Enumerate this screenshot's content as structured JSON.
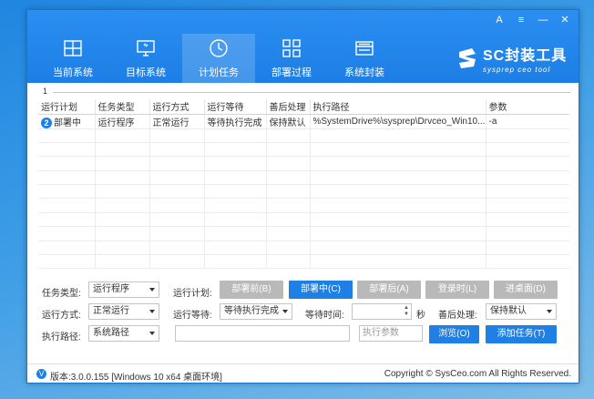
{
  "window_controls": [
    "A",
    "≡",
    "—",
    "✕"
  ],
  "nav": [
    {
      "label": "当前系统",
      "icon": "windows-icon"
    },
    {
      "label": "目标系统",
      "icon": "monitor-icon"
    },
    {
      "label": "计划任务",
      "icon": "clock-icon",
      "active": true
    },
    {
      "label": "部署过程",
      "icon": "grid-icon"
    },
    {
      "label": "系统封装",
      "icon": "drive-icon"
    }
  ],
  "logo": {
    "title": "SC封装工具",
    "subtitle": "sysprep ceo tool"
  },
  "tab_number": "1",
  "table": {
    "headers": [
      "运行计划",
      "任务类型",
      "运行方式",
      "运行等待",
      "善后处理",
      "执行路径",
      "参数"
    ],
    "rows": [
      {
        "badge": "2",
        "cells": [
          "部署中",
          "运行程序",
          "正常运行",
          "等待执行完成",
          "保持默认",
          "%SystemDrive%\\sysprep\\Drvceo_Win10...",
          "-a"
        ]
      }
    ]
  },
  "form": {
    "task_type_label": "任务类型:",
    "task_type_value": "运行程序",
    "run_plan_label": "运行计划:",
    "plan_buttons": [
      "部署前(B)",
      "部署中(C)",
      "部署后(A)",
      "登录时(L)",
      "进桌面(D)"
    ],
    "run_mode_label": "运行方式:",
    "run_mode_value": "正常运行",
    "run_wait_label": "运行等待:",
    "run_wait_value": "等待执行完成",
    "wait_time_label": "等待时间:",
    "wait_time_value": "",
    "seconds_label": "秒",
    "after_label": "善后处理:",
    "after_value": "保持默认",
    "exec_path_label": "执行路径:",
    "exec_path_value": "系统路径",
    "path_input_value": "",
    "param_placeholder": "执行参数",
    "browse_label": "浏览(O)",
    "add_task_label": "添加任务(T)"
  },
  "footer": {
    "version_icon": "V",
    "version": "版本:3.0.0.155 [Windows 10 x64 桌面环境]",
    "copyright": "Copyright © SysCeo.com All Rights Reserved."
  },
  "colors": {
    "accent": "#1e7fe4",
    "disabled_button": "#b9b9b9"
  }
}
